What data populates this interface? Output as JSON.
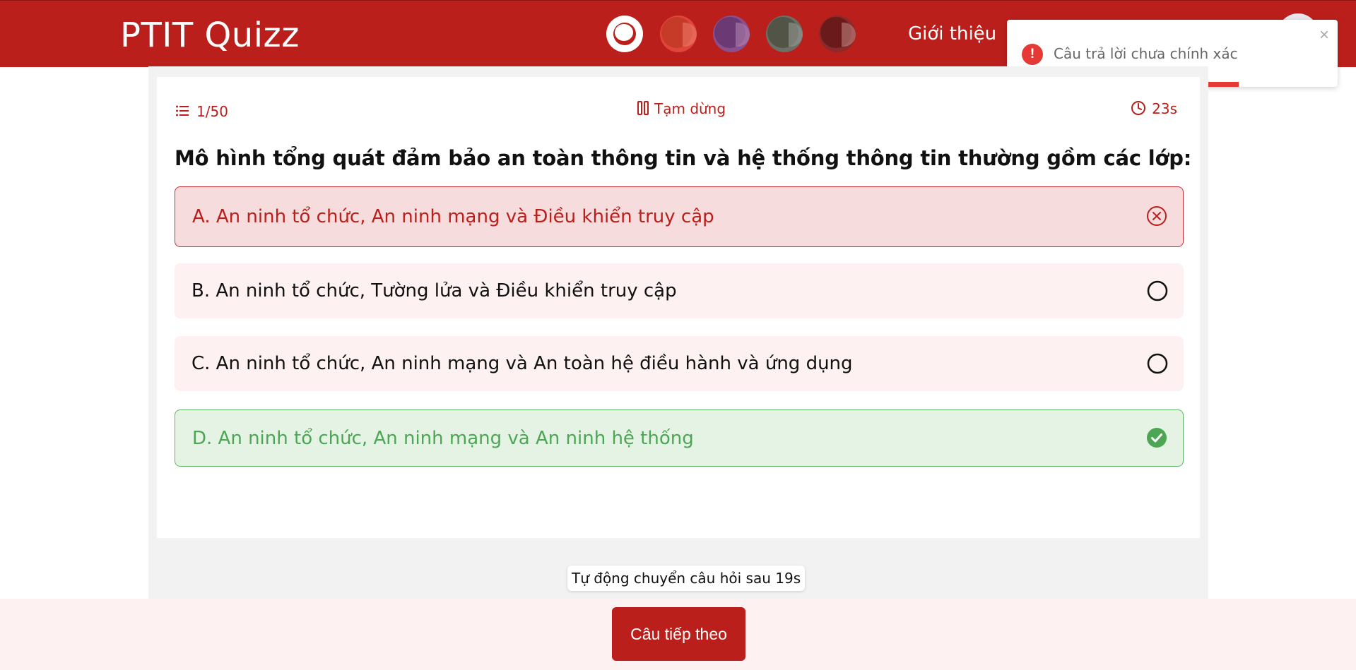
{
  "header": {
    "brand": "PTIT Quizz",
    "nav_link": "Giới thiệu",
    "theme_colors": [
      "#ffffff",
      "#c63a28",
      "#6b3a74",
      "#525448",
      "#6a1a1a"
    ]
  },
  "toast": {
    "message": "Câu trả lời chưa chính xác",
    "icon": "exclamation-icon",
    "close": "×",
    "progress": 0.7,
    "color": "#e53935"
  },
  "quiz": {
    "counter": "1/50",
    "pause_label": "Tạm dừng",
    "timer": "23s",
    "question": "Mô hình tổng quát đảm bảo an toàn thông tin và hệ thống thông tin thường gồm các lớp:",
    "options": [
      {
        "label": "A. An ninh tổ chức, An ninh mạng và Điều khiển truy cập",
        "state": "wrong"
      },
      {
        "label": "B. An ninh tổ chức, Tường lửa và Điều khiển truy cập",
        "state": "neutral"
      },
      {
        "label": "C. An ninh tổ chức, An ninh mạng và An toàn hệ điều hành và ứng dụng",
        "state": "neutral"
      },
      {
        "label": "D. An ninh tổ chức, An ninh mạng và An ninh hệ thống",
        "state": "correct"
      }
    ],
    "auto_next": "Tự động chuyển câu hỏi sau 19s",
    "next_button": "Câu tiếp theo"
  },
  "colors": {
    "primary": "#bb1f1b",
    "wrong_bg": "#f6dcdd",
    "correct": "#4ca653",
    "correct_bg": "#e5f3e5"
  }
}
